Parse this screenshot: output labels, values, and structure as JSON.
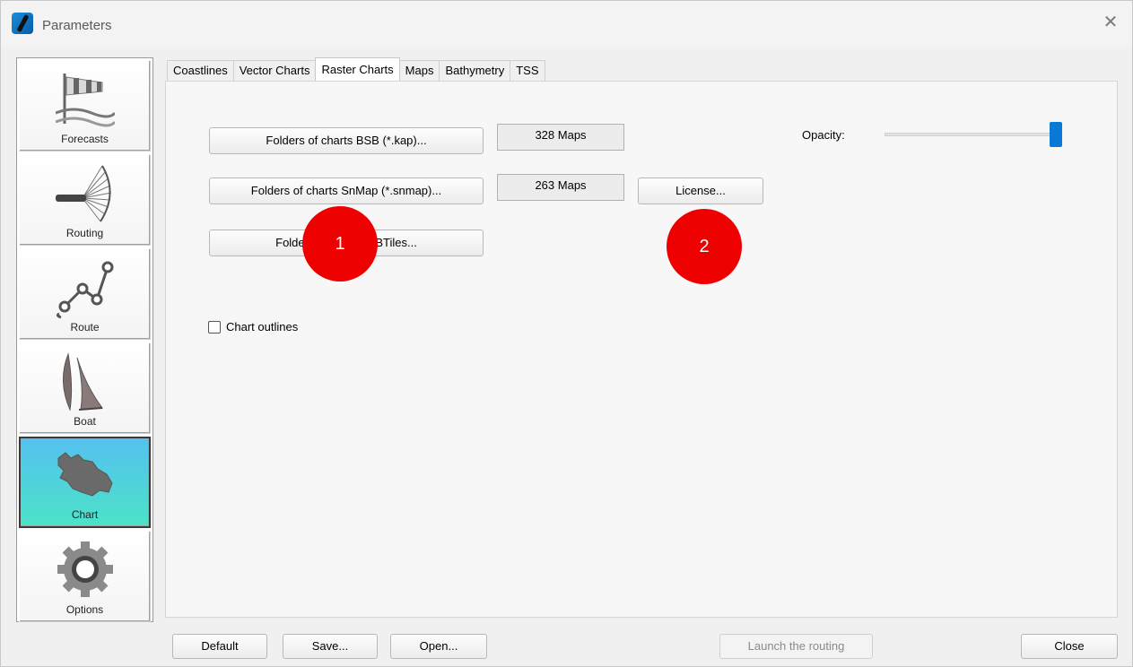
{
  "window": {
    "title": "Parameters"
  },
  "sidebar": {
    "items": [
      {
        "label": "Forecasts",
        "icon": "windsock-icon"
      },
      {
        "label": "Routing",
        "icon": "fan-routing-icon"
      },
      {
        "label": "Route",
        "icon": "route-icon"
      },
      {
        "label": "Boat",
        "icon": "sails-icon"
      },
      {
        "label": "Chart",
        "icon": "chart-map-icon",
        "active": true
      },
      {
        "label": "Options",
        "icon": "gear-icon"
      }
    ]
  },
  "tabs": [
    {
      "label": "Coastlines"
    },
    {
      "label": "Vector Charts"
    },
    {
      "label": "Raster Charts",
      "active": true
    },
    {
      "label": "Maps"
    },
    {
      "label": "Bathymetry"
    },
    {
      "label": "TSS"
    }
  ],
  "raster": {
    "bsb_button": "Folders of charts BSB (*.kap)...",
    "bsb_count": "328 Maps",
    "snmap_button": "Folders of charts SnMap (*.snmap)...",
    "snmap_count": "263 Maps",
    "license_button": "License...",
    "mbtiles_button": "Folders of charts MBTiles...",
    "opacity_label": "Opacity:",
    "opacity_value": 1.0,
    "outlines_label": "Chart outlines",
    "outlines_checked": false
  },
  "footer": {
    "default": "Default",
    "save": "Save...",
    "open": "Open...",
    "launch": "Launch the routing",
    "close": "Close"
  },
  "markers": [
    {
      "label": "1"
    },
    {
      "label": "2"
    }
  ],
  "colors": {
    "accent": "#0a78d7",
    "marker": "#ee0000",
    "active_sidebar_top": "#54c1ef",
    "active_sidebar_bottom": "#4ce3c8"
  }
}
